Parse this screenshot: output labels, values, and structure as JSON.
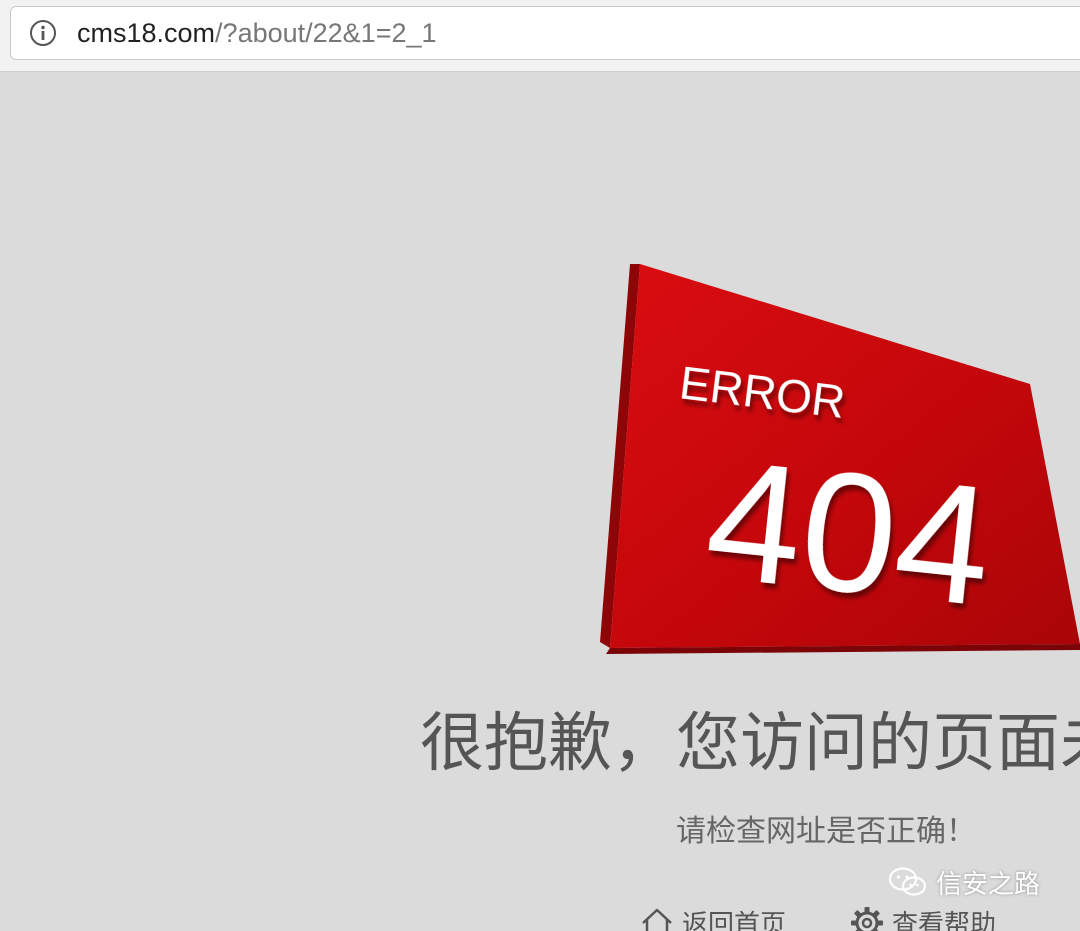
{
  "browser": {
    "url_host": "cms18.com",
    "url_path": "/?about/22&1=2_1",
    "info_icon": "info-icon"
  },
  "error_graphic": {
    "error_label": "ERROR",
    "code": "404",
    "colors": {
      "face": "#c4070b",
      "side": "#8e0508",
      "text": "#ffffff"
    }
  },
  "message": {
    "headline": "很抱歉，您访问的页面未",
    "subtext": "请检查网址是否正确！"
  },
  "actions": [
    {
      "icon": "home-icon",
      "label": "返回首页"
    },
    {
      "icon": "gear-icon",
      "label": "查看帮助"
    }
  ],
  "watermark": {
    "icon": "wechat-icon",
    "text": "信安之路"
  }
}
